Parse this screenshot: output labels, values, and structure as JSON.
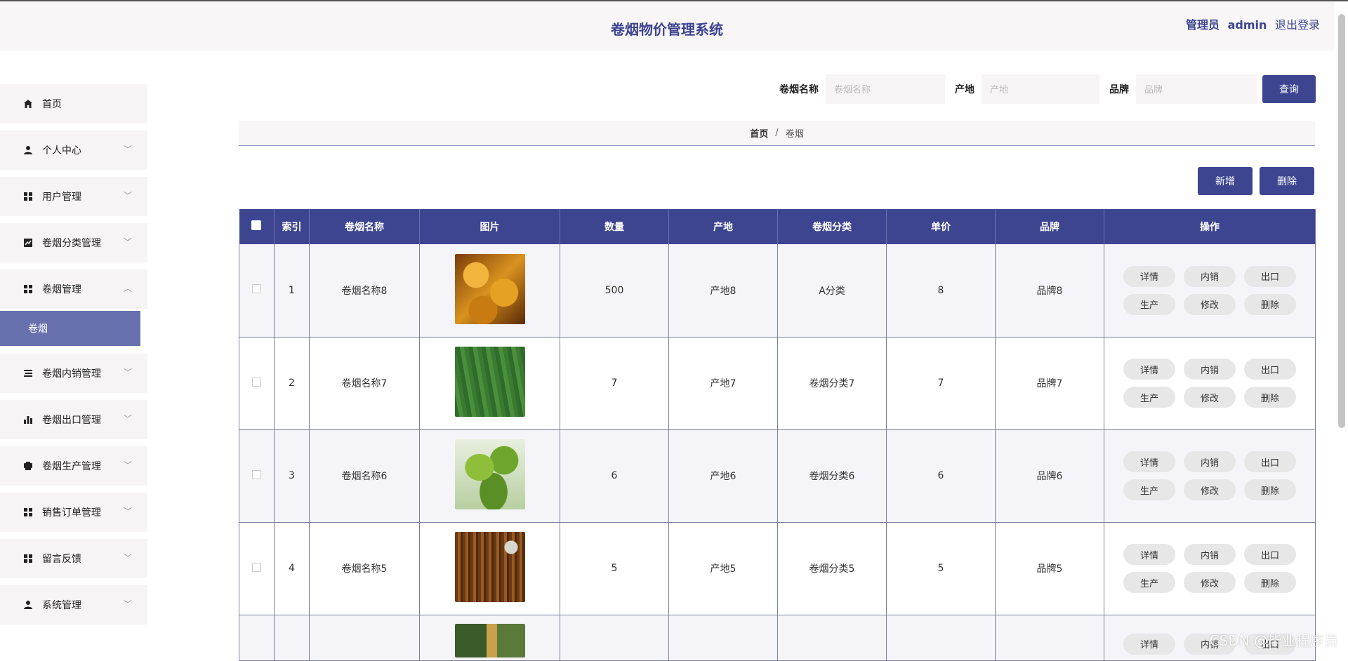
{
  "header": {
    "title": "卷烟物价管理系统",
    "role": "管理员",
    "username": "admin",
    "logout": "退出登录"
  },
  "sidebar": {
    "items": [
      {
        "label": "首页",
        "icon": "home-icon"
      },
      {
        "label": "个人中心",
        "icon": "person-icon"
      },
      {
        "label": "用户管理",
        "icon": "grid-icon"
      },
      {
        "label": "卷烟分类管理",
        "icon": "chart-icon"
      },
      {
        "label": "卷烟管理",
        "icon": "grid-icon"
      },
      {
        "label": "卷烟内销管理",
        "icon": "list-icon"
      },
      {
        "label": "卷烟出口管理",
        "icon": "bar-chart-icon"
      },
      {
        "label": "卷烟生产管理",
        "icon": "printer-icon"
      },
      {
        "label": "销售订单管理",
        "icon": "grid-icon"
      },
      {
        "label": "留言反馈",
        "icon": "grid-icon"
      },
      {
        "label": "系统管理",
        "icon": "person-icon"
      }
    ],
    "active_sub": "卷烟"
  },
  "search": {
    "name_label": "卷烟名称",
    "name_placeholder": "卷烟名称",
    "origin_label": "产地",
    "origin_placeholder": "产地",
    "brand_label": "品牌",
    "brand_placeholder": "品牌",
    "button": "查询"
  },
  "breadcrumb": {
    "home": "首页",
    "sep": "/",
    "current": "卷烟"
  },
  "actions": {
    "add": "新增",
    "delete": "删除"
  },
  "table": {
    "headers": [
      "索引",
      "卷烟名称",
      "图片",
      "数量",
      "产地",
      "卷烟分类",
      "单价",
      "品牌",
      "操作"
    ],
    "ops": [
      "详情",
      "内销",
      "出口",
      "生产",
      "修改",
      "删除"
    ],
    "rows": [
      {
        "index": "1",
        "name": "卷烟名称8",
        "qty": "500",
        "origin": "产地8",
        "category": "A分类",
        "price": "8",
        "brand": "品牌8"
      },
      {
        "index": "2",
        "name": "卷烟名称7",
        "qty": "7",
        "origin": "产地7",
        "category": "卷烟分类7",
        "price": "7",
        "brand": "品牌7"
      },
      {
        "index": "3",
        "name": "卷烟名称6",
        "qty": "6",
        "origin": "产地6",
        "category": "卷烟分类6",
        "price": "6",
        "brand": "品牌6"
      },
      {
        "index": "4",
        "name": "卷烟名称5",
        "qty": "5",
        "origin": "产地5",
        "category": "卷烟分类5",
        "price": "5",
        "brand": "品牌5"
      }
    ],
    "partial_ops": [
      "详情",
      "内销",
      "出口"
    ]
  },
  "watermark": "CSDN @毕业程序员",
  "colors": {
    "primary": "#3d4591",
    "active_sub": "#6870ad"
  }
}
